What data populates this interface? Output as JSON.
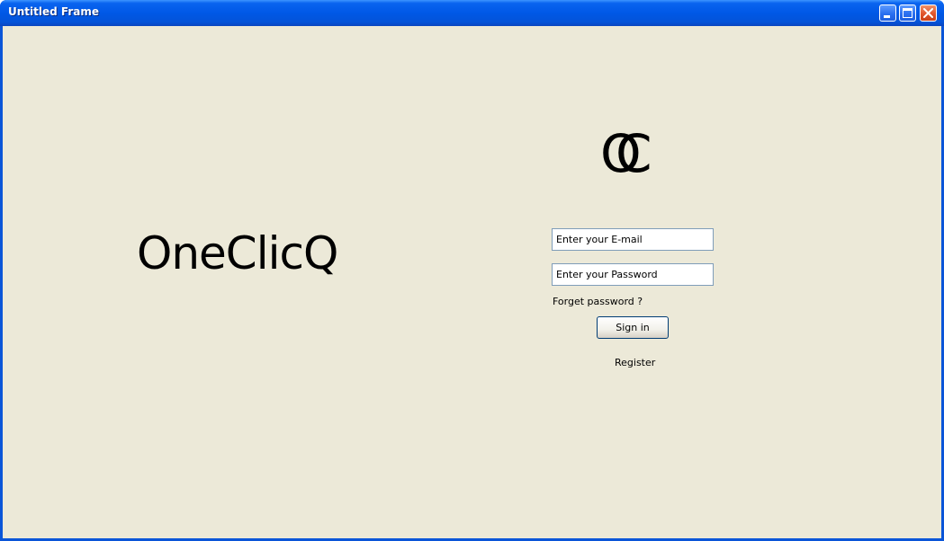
{
  "window": {
    "title": "Untitled Frame",
    "controls": {
      "minimize": "minimize-icon",
      "maximize": "maximize-icon",
      "close": "close-icon"
    }
  },
  "main": {
    "brand_name": "OneClicQ",
    "logo": {
      "letter_o": "O",
      "letter_c": "C"
    }
  },
  "login": {
    "email_text": "Enter your E-mail",
    "password_text": "Enter your Password",
    "forget_label": "Forget password ?",
    "signin_label": "Sign in",
    "register_label": "Register"
  },
  "colors": {
    "titlebar": "#0058e6",
    "client_background": "#ece9d8",
    "input_border": "#7f9db9",
    "close_button": "#e0542b"
  }
}
